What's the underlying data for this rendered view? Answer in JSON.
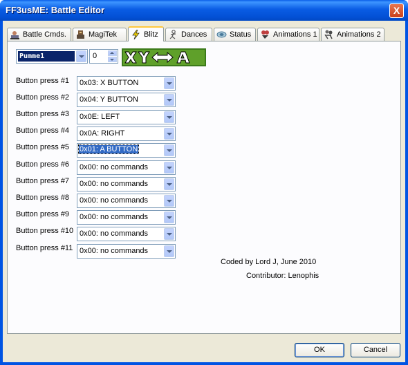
{
  "window": {
    "title": "FF3usME: Battle Editor",
    "close_glyph": "X"
  },
  "tabs": [
    {
      "label": "Battle Cmds.",
      "icon": "battle-cmds-icon"
    },
    {
      "label": "MagiTek",
      "icon": "magitek-icon"
    },
    {
      "label": "Blitz",
      "icon": "lightning-icon"
    },
    {
      "label": "Dances",
      "icon": "dances-icon"
    },
    {
      "label": "Status",
      "icon": "status-icon"
    },
    {
      "label": "Animations 1",
      "icon": "animations1-icon"
    },
    {
      "label": "Animations 2",
      "icon": "animations2-icon"
    }
  ],
  "selected_tab": "Blitz",
  "blitz": {
    "selected_name": "Pumme1",
    "index_value": "0",
    "preview_icon": "blitz-input-sequence-graphic"
  },
  "presses": [
    {
      "label": "Button press #1",
      "value": "0x03: X BUTTON"
    },
    {
      "label": "Button press #2",
      "value": "0x04: Y BUTTON"
    },
    {
      "label": "Button press #3",
      "value": "0x0E: LEFT"
    },
    {
      "label": "Button press #4",
      "value": "0x0A: RIGHT"
    },
    {
      "label": "Button press #5",
      "value": "0x01: A BUTTON"
    },
    {
      "label": "Button press #6",
      "value": "0x00: no commands"
    },
    {
      "label": "Button press #7",
      "value": "0x00: no commands"
    },
    {
      "label": "Button press #8",
      "value": "0x00: no commands"
    },
    {
      "label": "Button press #9",
      "value": "0x00: no commands"
    },
    {
      "label": "Button press #10",
      "value": "0x00: no commands"
    },
    {
      "label": "Button press #11",
      "value": "0x00: no commands"
    }
  ],
  "credits": {
    "coded_by": "Coded by Lord J, June 2010",
    "contributor": "Contributor: Lenophis"
  },
  "buttons": {
    "ok": "OK",
    "cancel": "Cancel"
  },
  "colors": {
    "titlebar": "#0054e3",
    "selection": "#316ac5",
    "tab_highlight": "#ffc83c",
    "preview_bg": "#4a8a1e"
  }
}
